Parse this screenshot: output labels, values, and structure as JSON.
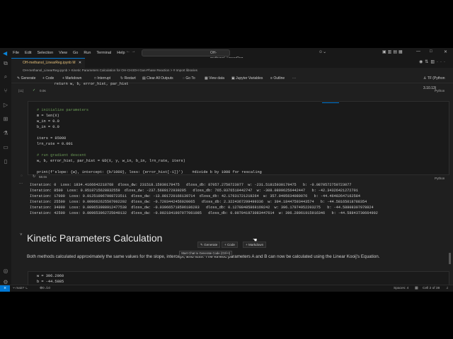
{
  "menu": [
    "File",
    "Edit",
    "Selection",
    "View",
    "Go",
    "Run",
    "Terminal",
    "Help"
  ],
  "search_text": "OH-methanol_LinearReg",
  "tab": {
    "label": "OH-methanol_LinearReg.ipynb",
    "modified": "M"
  },
  "breadcrumb": [
    "OH-methanol_LinearReg.ipynb",
    "Kinetic Parameters Calculation for OH-CH3OH Gas-Phase Reaction",
    "# Import libraries"
  ],
  "toolbar": {
    "generate": "Generate",
    "code": "Code",
    "markdown": "Markdown",
    "interrupt": "Interrupt",
    "restart": "Restart",
    "clear": "Clear All Outputs",
    "goto": "Go To",
    "viewdata": "View data",
    "variables": "Jupyter Variables",
    "outline": "Outline",
    "more": "···",
    "kernel": "TF (Python 3.10.13)"
  },
  "cell1": {
    "code": "    return w, b, error_hist, par_hist",
    "exec_count": "[11]",
    "time": "0.0s",
    "lang": "Python"
  },
  "cell2": {
    "lines": [
      "# initialize parameters",
      "m = len(X)",
      "w_in = 0.0",
      "b_in = 0.0",
      "",
      "iters = 85000",
      "lrn_rate = 0.001",
      "",
      "# run gradient descent",
      "w, b, error_hist, par_hist = GD(X, y, w_in, b_in, lrn_rate, iters)",
      "",
      "print(f'slope: {w}, intercept: {b/1000}, loss: {error_hist[-1]}')    #divide b by 1000 for rescaling"
    ],
    "time": "58.6s",
    "lang": "Python",
    "output": [
      "Iteration: 0  Loss: 1834.4166642218768  dloss_dw: 231518.15930179475   dloss_db: 87057.2750723077  w: -231.51815930179475   b: -0.0870572750723077",
      "Iteration: 8500  Loss: 0.9518715628832559  dloss_dw: -237.5689172939295   dloss_db: 765.9376510442747  w: -308.08996256442447   b: -42.34326421272701",
      "Iteration: 17000  Loss: 0.012510967008723511  dloss_dw: -13.081720166139714  dloss_db: 42.17631721219264  w: 357.9495634080076   b: -44.46482647162584",
      "Iteration: 25500  Loss: 0.009662625507002202  dloss_dw: -0.7203442456020065   dloss_db: 2.3224367299499336  w: 394.1844759344357​4   b: -44.58165018788354",
      "Iteration: 34000  Loss: 0.009653988912477538  dloss_dw: -0.039665718596186283   dloss_db: 0.127884858681O9242  w: 396.17974952203275   b: -44.58808307978824",
      "Iteration: 42500  Loss: 0.009653962725040132  dloss_dw: -0.0021841907977061085   dloss_db: 0.007041973083447614  w: 396.28961915916346   b: -44.58843730664902"
    ]
  },
  "markdown": {
    "heading": "Kinetic Parameters Calculation",
    "paragraph": "Both methods calculated approximately the same values for the slope, intercept, and loss. The kinetic parameters A and B can now be calculated using the Linear Kooij's Equation."
  },
  "overlay": {
    "generate": "Generate",
    "code": "Code",
    "markdown": "Markdown",
    "tooltip": "Start Chat to Generate Code (Ctrl+I)"
  },
  "cell3": {
    "lines": [
      "w = 396.2960",
      "b = -44.5885"
    ]
  },
  "status": {
    "branch": "main*",
    "errors": "0",
    "warnings": "0",
    "spaces": "Spaces: 4",
    "cell": "Cell 2 of 38"
  }
}
